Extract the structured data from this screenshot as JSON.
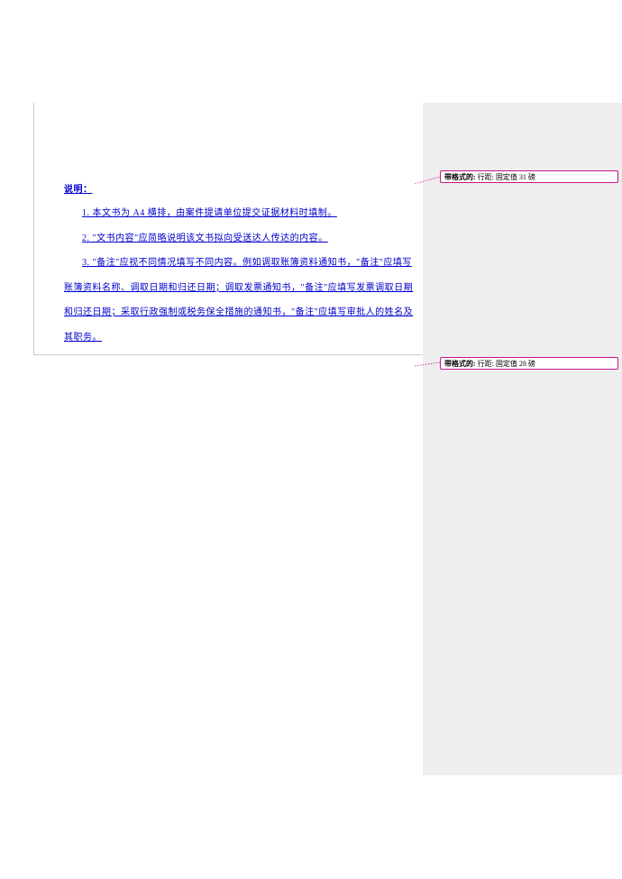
{
  "document": {
    "heading": "说明：",
    "paragraphs": [
      "1. 本文书为 A4 横排，由案件提请单位提交证据材料时填制。",
      "2. \"文书内容\"应简略说明该文书拟向受送达人传达的内容。",
      "3. \"备注\"应视不同情况填写不同内容。例如调取账簿资料通知书，\"备注\"应填写账簿资料名称、调取日期和归还日期；调取发票通知书，\"备注\"应填写发票调取日期和归还日期；采取行政强制或税务保全措施的通知书，\"备注\"应填写审批人的姓名及其职务。"
    ]
  },
  "callouts": [
    {
      "label": "带格式的:",
      "text": " 行距: 固定值 31 磅"
    },
    {
      "label": "带格式的:",
      "text": " 行距: 固定值 28 磅"
    }
  ]
}
